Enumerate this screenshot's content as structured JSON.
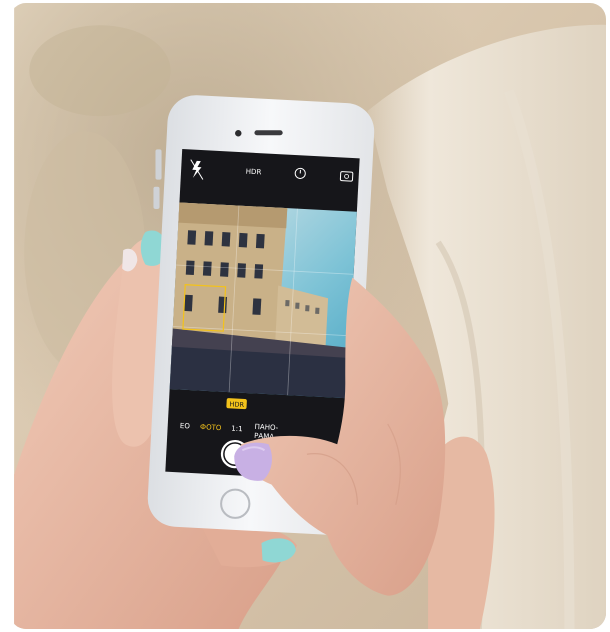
{
  "photo": {
    "subject": "hands holding a smartphone taking a photo of a building",
    "colors": {
      "background": "#d8c6ad",
      "hair": "#ece4d6",
      "skin": "#e7b9a4",
      "phone_body": "#f1f2f4",
      "screen": "#16161a",
      "nail_mint": "#8fd7d4",
      "nail_lilac": "#c8b0e4",
      "hdr_badge": "#f3c21b"
    }
  },
  "camera_ui": {
    "top_bar": {
      "flash_icon": "flash-off-icon",
      "hdr_label": "HDR",
      "timer_icon": "timer-icon",
      "switch_camera_icon": "camera-switch-icon"
    },
    "hdr_badge": "HDR",
    "modes": [
      "ЕО",
      "ФОТО",
      "1:1",
      "ПАНО-",
      "РАМА"
    ]
  }
}
